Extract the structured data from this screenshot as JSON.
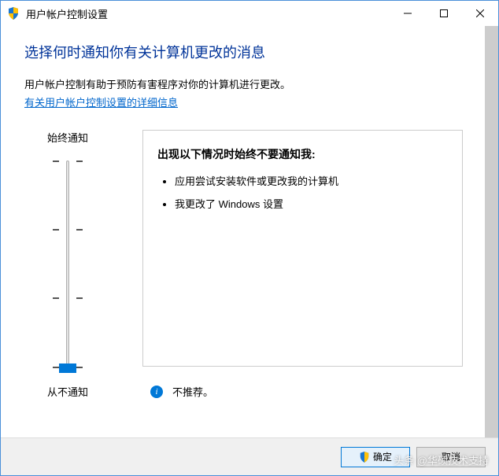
{
  "titlebar": {
    "title": "用户帐户控制设置"
  },
  "page": {
    "heading": "选择何时通知你有关计算机更改的消息",
    "description": "用户帐户控制有助于预防有害程序对你的计算机进行更改。",
    "link": "有关用户帐户控制设置的详细信息"
  },
  "slider": {
    "top_label": "始终通知",
    "bottom_label": "从不通知"
  },
  "infobox": {
    "heading": "出现以下情况时始终不要通知我:",
    "items": [
      "应用尝试安装软件或更改我的计算机",
      "我更改了 Windows 设置"
    ],
    "recommendation": "不推荐。"
  },
  "buttons": {
    "ok": "确定",
    "cancel": "取消"
  },
  "watermark": "头条 @华硕技术支持"
}
